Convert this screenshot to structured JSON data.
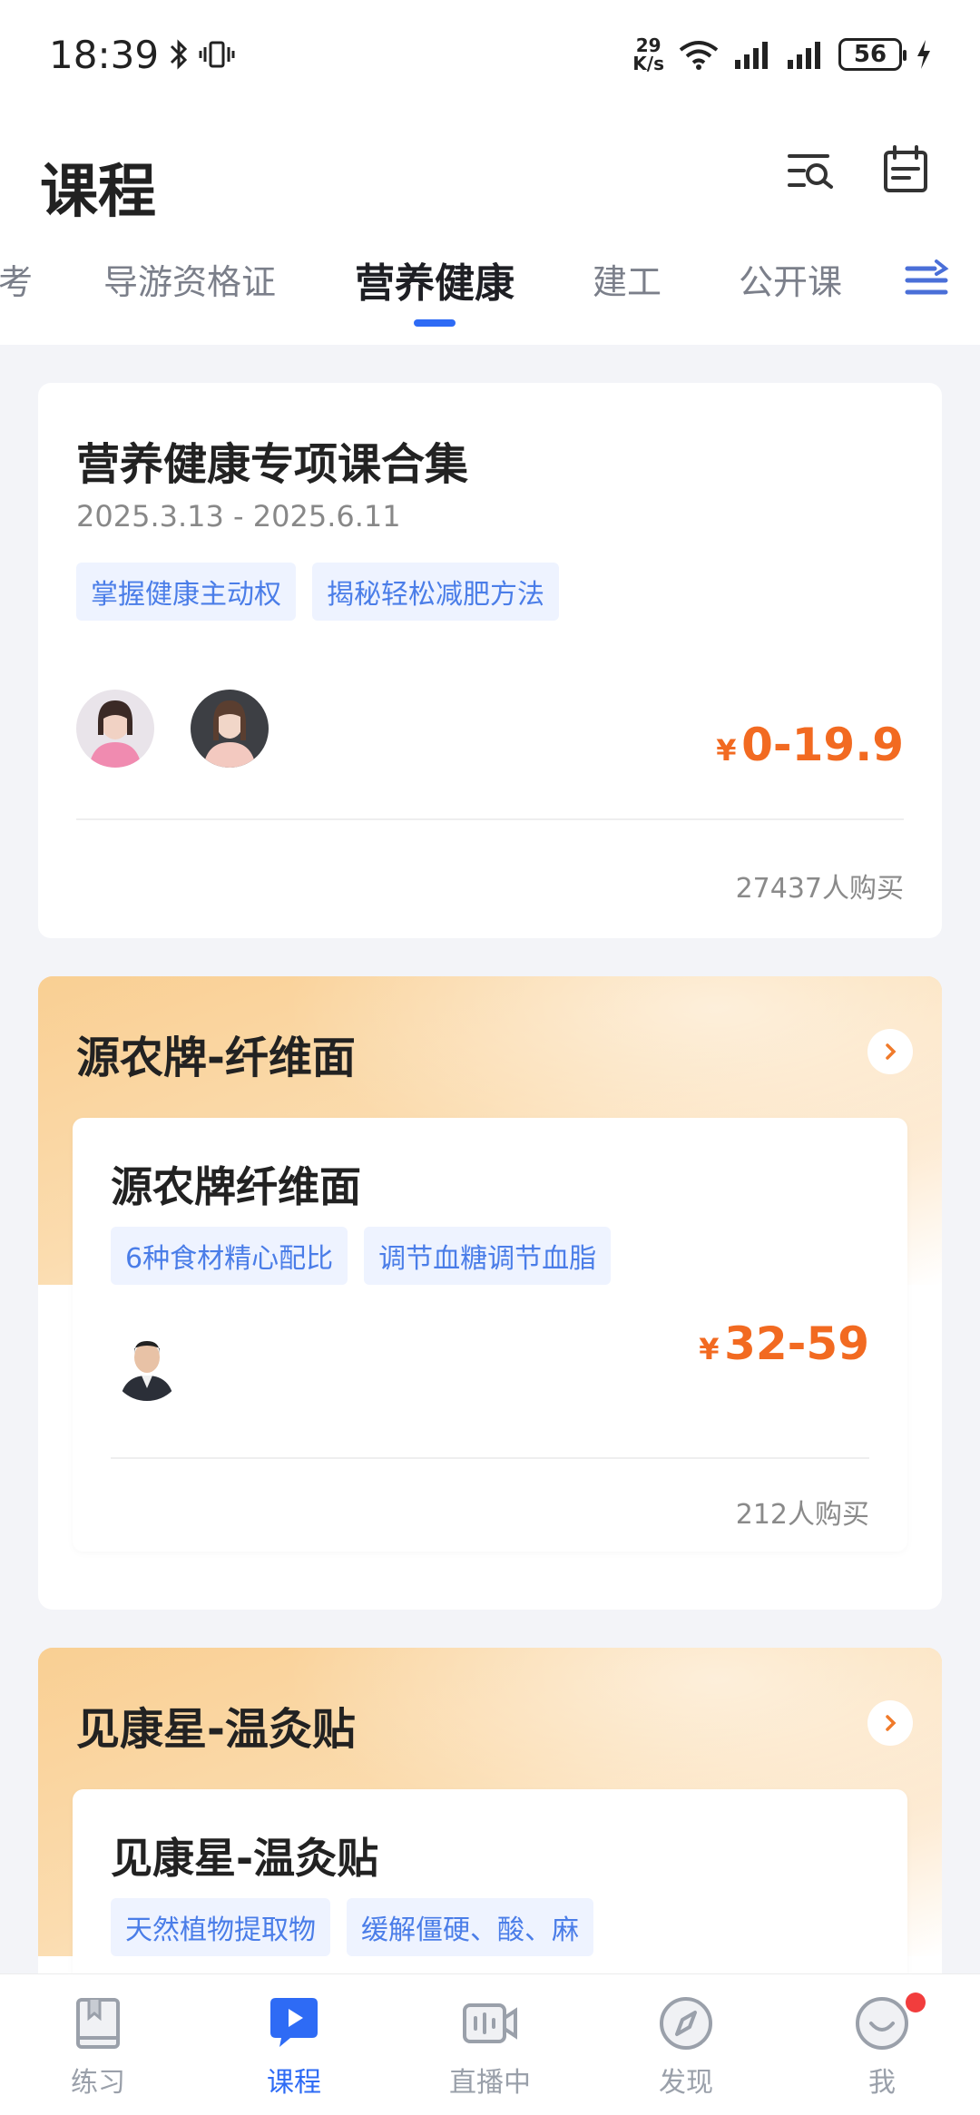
{
  "status_bar": {
    "time": "18:39",
    "net_speed_value": "29",
    "net_speed_unit": "K/s",
    "battery": "56"
  },
  "header": {
    "title": "课程"
  },
  "tabs": [
    {
      "label": "考"
    },
    {
      "label": "导游资格证"
    },
    {
      "label": "营养健康"
    },
    {
      "label": "建工"
    },
    {
      "label": "公开课"
    }
  ],
  "course_card": {
    "title": "营养健康专项课合集",
    "date_range": "2025.3.13 - 2025.6.11",
    "tags": [
      "掌握健康主动权",
      "揭秘轻松减肥方法"
    ],
    "price_symbol": "¥",
    "price": "0-19.9",
    "buyers": "27437人购买"
  },
  "promo_sections": [
    {
      "title": "源农牌-纤维面",
      "item": {
        "title": "源农牌纤维面",
        "tags": [
          "6种食材精心配比",
          "调节血糖调节血脂"
        ],
        "price_symbol": "¥",
        "price": "32-59",
        "buyers": "212人购买"
      }
    },
    {
      "title": "见康星-温灸贴",
      "item": {
        "title": "见康星-温灸贴",
        "tags": [
          "天然植物提取物",
          "缓解僵硬、酸、麻"
        ]
      }
    }
  ],
  "bottom_nav": [
    {
      "label": "练习"
    },
    {
      "label": "课程"
    },
    {
      "label": "直播中"
    },
    {
      "label": "发现"
    },
    {
      "label": "我"
    }
  ],
  "colors": {
    "accent": "#2e6bf5",
    "price": "#f26a21",
    "tag_text": "#4a7de8",
    "tag_bg": "#eef3ff",
    "notification": "#f23d3d"
  }
}
